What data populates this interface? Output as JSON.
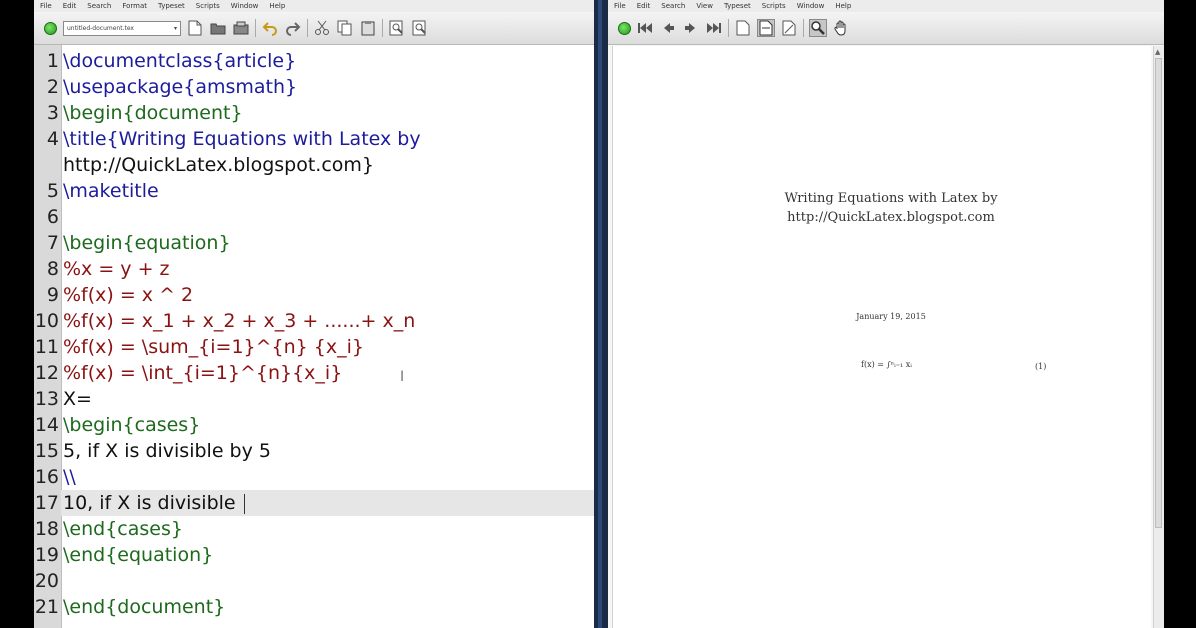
{
  "editor": {
    "menu": [
      "File",
      "Edit",
      "Search",
      "Format",
      "Typeset",
      "Scripts",
      "Window",
      "Help"
    ],
    "file_selector": "untitled-document.tex",
    "lines": [
      {
        "n": "1",
        "text": "\\documentclass{article}",
        "kind": "cmd"
      },
      {
        "n": "2",
        "text": "\\usepackage{amsmath}",
        "kind": "cmd"
      },
      {
        "n": "3",
        "text": "\\begin{document}",
        "kind": "env"
      },
      {
        "n": "4",
        "text": "\\title{Writing Equations with Latex by",
        "kind": "cmd"
      },
      {
        "n": "",
        "text": "http://QuickLatex.blogspot.com}",
        "kind": "text"
      },
      {
        "n": "5",
        "text": "\\maketitle",
        "kind": "cmd"
      },
      {
        "n": "6",
        "text": "",
        "kind": "text"
      },
      {
        "n": "7",
        "text": "\\begin{equation}",
        "kind": "env"
      },
      {
        "n": "8",
        "text": "%x = y + z",
        "kind": "comment"
      },
      {
        "n": "9",
        "text": "%f(x) = x ^ 2",
        "kind": "comment"
      },
      {
        "n": "10",
        "text": "%f(x) = x_1 + x_2 + x_3 + ......+ x_n",
        "kind": "comment"
      },
      {
        "n": "11",
        "text": "%f(x) = \\sum_{i=1}^{n} {x_i}",
        "kind": "comment"
      },
      {
        "n": "12",
        "text": "%f(x) = \\int_{i=1}^{n}{x_i}",
        "kind": "comment"
      },
      {
        "n": "13",
        "text": "X=",
        "kind": "text"
      },
      {
        "n": "14",
        "text": "\\begin{cases}",
        "kind": "env"
      },
      {
        "n": "15",
        "text": "5, if X is divisible by 5",
        "kind": "text"
      },
      {
        "n": "16",
        "text": "\\\\",
        "kind": "cmd"
      },
      {
        "n": "17",
        "text": "10, if X is divisible ",
        "kind": "text",
        "current": true
      },
      {
        "n": "18",
        "text": "\\end{cases}",
        "kind": "env"
      },
      {
        "n": "19",
        "text": "\\end{equation}",
        "kind": "env"
      },
      {
        "n": "20",
        "text": "",
        "kind": "text"
      },
      {
        "n": "21",
        "text": "\\end{document}",
        "kind": "env"
      }
    ]
  },
  "viewer": {
    "menu": [
      "File",
      "Edit",
      "Search",
      "View",
      "Typeset",
      "Scripts",
      "Window",
      "Help"
    ],
    "doc": {
      "title_line1": "Writing Equations with Latex by",
      "title_line2": "http://QuickLatex.blogspot.com",
      "date": "January 19, 2015",
      "equation": "f(x) = ∫ⁿᵢ₌₁ xᵢ",
      "equation_number": "(1)"
    }
  },
  "colors": {
    "command": "#1c1c9c",
    "environment": "#1d6a1d",
    "comment": "#8b1212",
    "divider": "#1b2a45"
  }
}
